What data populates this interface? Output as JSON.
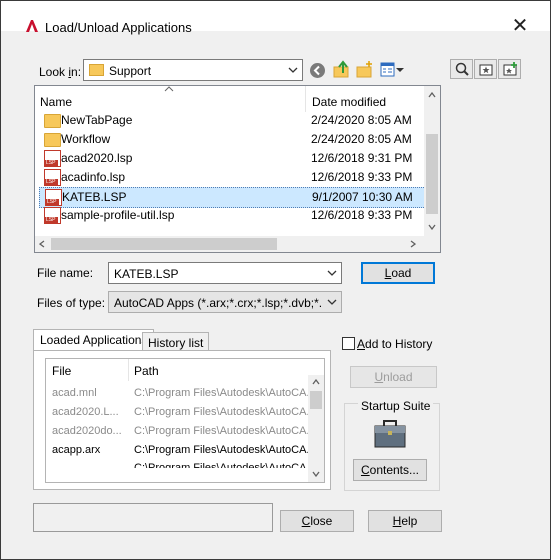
{
  "window": {
    "title": "Load/Unload Applications",
    "close_glyph": "✕"
  },
  "look_in": {
    "label_pre": "Look ",
    "label_key": "i",
    "label_post": "n:",
    "value": "Support"
  },
  "toolbar": {
    "back_icon": "back-arrow-icon",
    "up_icon": "up-folder-icon",
    "new_folder_icon": "new-folder-icon",
    "views_icon": "views-menu-icon"
  },
  "right_tools": [
    "find-icon",
    "favorites-icon",
    "add-to-favorites-icon"
  ],
  "file_list": {
    "headers": {
      "name": "Name",
      "date": "Date modified"
    },
    "rows": [
      {
        "name": "NewTabPage",
        "date": "2/24/2020 8:05 AM",
        "type": "folder"
      },
      {
        "name": "Workflow",
        "date": "2/24/2020 8:05 AM",
        "type": "folder"
      },
      {
        "name": "acad2020.lsp",
        "date": "12/6/2018 9:31 PM",
        "type": "lsp"
      },
      {
        "name": "acadinfo.lsp",
        "date": "12/6/2018 9:33 PM",
        "type": "lsp"
      },
      {
        "name": "KATEB.LSP",
        "date": "9/1/2007 10:30 AM",
        "type": "lsp"
      },
      {
        "name": "sample-profile-util.lsp",
        "date": "12/6/2018 9:33 PM",
        "type": "lsp"
      }
    ],
    "selected_index": 4,
    "icon_text": "LSP"
  },
  "file_name": {
    "label": "File name:",
    "value": "KATEB.LSP"
  },
  "files_of_type": {
    "label": "Files of type:",
    "value": "AutoCAD Apps (*.arx;*.crx;*.lsp;*.dvb;*.dbx;*."
  },
  "buttons": {
    "load_key": "L",
    "load_rest": "oad",
    "unload_key": "U",
    "unload_rest": "nload",
    "contents_key": "C",
    "contents_rest": "ontents...",
    "close_key": "C",
    "close_rest": "lose",
    "help_key": "H",
    "help_rest": "elp"
  },
  "tabs": [
    {
      "label": "Loaded Applications",
      "active": true
    },
    {
      "label": "History list",
      "active": false
    }
  ],
  "loaded_apps": {
    "headers": {
      "file": "File",
      "path": "Path"
    },
    "rows": [
      {
        "file": "acad.mnl",
        "path": "C:\\Program Files\\Autodesk\\AutoCA...",
        "gray": true
      },
      {
        "file": "acad2020.L...",
        "path": "C:\\Program Files\\Autodesk\\AutoCA...",
        "gray": true
      },
      {
        "file": "acad2020do...",
        "path": "C:\\Program Files\\Autodesk\\AutoCA...",
        "gray": true
      },
      {
        "file": "acapp.arx",
        "path": "C:\\Program Files\\Autodesk\\AutoCA...",
        "gray": false
      },
      {
        "file": "",
        "path": "C:\\Program Files\\Autodesk\\AutoCA...",
        "gray": false
      }
    ]
  },
  "add_to_history": {
    "label_key": "A",
    "label_rest": "dd to History",
    "checked": false
  },
  "startup_suite": {
    "label": "Startup Suite",
    "icon": "briefcase-icon"
  }
}
